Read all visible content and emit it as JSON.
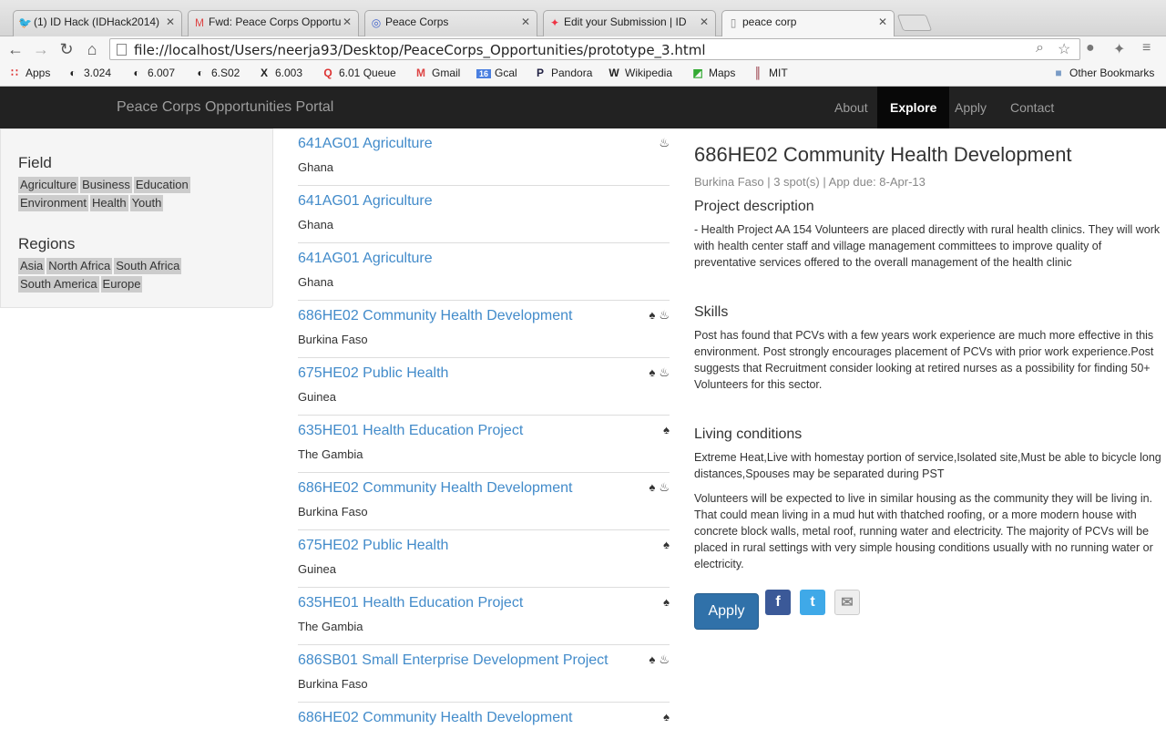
{
  "browser": {
    "tabs": [
      {
        "label": "(1) ID Hack (IDHack2014)",
        "icon": "twitter-icon"
      },
      {
        "label": "Fwd: Peace Corps Opportu",
        "icon": "gmail-icon"
      },
      {
        "label": "Peace Corps",
        "icon": "globe-icon"
      },
      {
        "label": "Edit your Submission | ID",
        "icon": "pinwheel-icon"
      },
      {
        "label": "peace corp",
        "icon": "page-icon"
      }
    ],
    "url": "file://localhost/Users/neerja93/Desktop/PeaceCorps_Opportunities/prototype_3.html",
    "bookmarks": [
      "Apps",
      "3.024",
      "6.007",
      "6.S02",
      "6.003",
      "6.01 Queue",
      "Gmail",
      "Gcal",
      "Pandora",
      "Wikipedia",
      "Maps",
      "MIT"
    ],
    "other_bookmarks": "Other Bookmarks"
  },
  "nav": {
    "brand": "Peace Corps Opportunities Portal",
    "links": [
      "About",
      "Explore",
      "Apply",
      "Contact"
    ],
    "active": "Explore"
  },
  "sidebar": {
    "field_heading": "Field",
    "fields": [
      "Agriculture",
      "Business",
      "Education",
      "Environment",
      "Health",
      "Youth"
    ],
    "regions_heading": "Regions",
    "regions": [
      "Asia",
      "North Africa",
      "South Africa",
      "South America",
      "Europe"
    ]
  },
  "list": [
    {
      "title": "641AG01 Agriculture",
      "country": "Ghana",
      "icons": [
        "fire-icon"
      ]
    },
    {
      "title": "641AG01 Agriculture",
      "country": "Ghana",
      "icons": []
    },
    {
      "title": "641AG01 Agriculture",
      "country": "Ghana",
      "icons": []
    },
    {
      "title": "686HE02 Community Health Development",
      "country": "Burkina Faso",
      "icons": [
        "tree-icon",
        "fire-icon"
      ]
    },
    {
      "title": "675HE02 Public Health",
      "country": "Guinea",
      "icons": [
        "tree-icon",
        "fire-icon"
      ]
    },
    {
      "title": "635HE01 Health Education Project",
      "country": "The Gambia",
      "icons": [
        "tree-icon"
      ]
    },
    {
      "title": "686HE02 Community Health Development",
      "country": "Burkina Faso",
      "icons": [
        "tree-icon",
        "fire-icon"
      ]
    },
    {
      "title": "675HE02 Public Health",
      "country": "Guinea",
      "icons": [
        "tree-icon"
      ]
    },
    {
      "title": "635HE01 Health Education Project",
      "country": "The Gambia",
      "icons": [
        "tree-icon"
      ]
    },
    {
      "title": "686SB01 Small Enterprise Development Project",
      "country": "Burkina Faso",
      "icons": [
        "tree-icon",
        "fire-icon"
      ]
    },
    {
      "title": "686HE02 Community Health Development",
      "country": "",
      "icons": [
        "tree-icon"
      ]
    }
  ],
  "detail": {
    "title": "686HE02 Community Health Development",
    "meta": "Burkina Faso | 3 spot(s) | App due: 8-Apr-13",
    "desc_heading": "Project description",
    "desc": "- Health Project AA 154 Volunteers are placed directly with rural health clinics. They will work with health center staff and village management committees to improve quality of preventative services offered to the overall management of the health clinic",
    "skills_heading": "Skills",
    "skills": "Post has found that PCVs with a few years work experience are much more effective in this environment. Post strongly encourages placement of PCVs with prior work experience.Post suggests that Recruitment consider looking at retired nurses as a possibility for finding 50+ Volunteers for this sector.",
    "living_heading": "Living conditions",
    "living1": "Extreme Heat,Live with homestay portion of service,Isolated site,Must be able to bicycle long distances,Spouses may be separated during PST",
    "living2": "Volunteers will be expected to live in similar housing as the community they will be living in. That could mean living in a mud hut with thatched roofing, or a more modern house with concrete block walls, metal roof, running water and electricity. The majority of PCVs will be placed in rural settings with very simple housing conditions usually with no running water or electricity.",
    "apply_label": "Apply"
  }
}
